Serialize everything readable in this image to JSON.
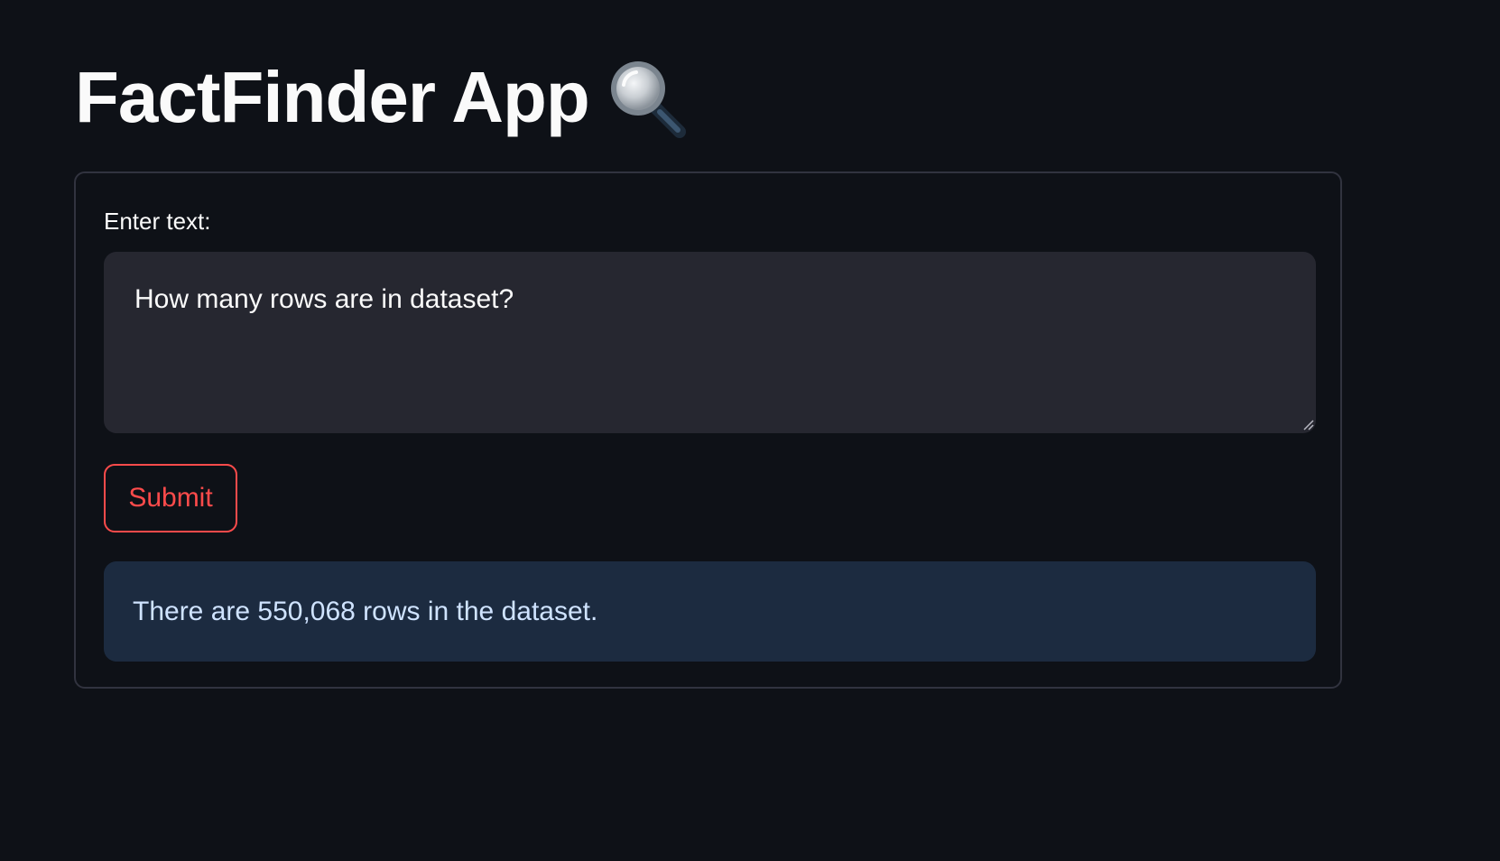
{
  "header": {
    "title": "FactFinder App",
    "title_icon": "magnifying-glass-icon"
  },
  "form": {
    "label": "Enter text:",
    "input_value": "How many rows are in dataset?",
    "submit_label": "Submit"
  },
  "result": {
    "text": "There are 550,068 rows in the dataset."
  },
  "colors": {
    "background": "#0e1117",
    "card_border": "#31333f",
    "input_background": "#262730",
    "accent": "#ff4b4b",
    "result_background": "#1c2b40",
    "result_text": "#cfe3ff"
  }
}
